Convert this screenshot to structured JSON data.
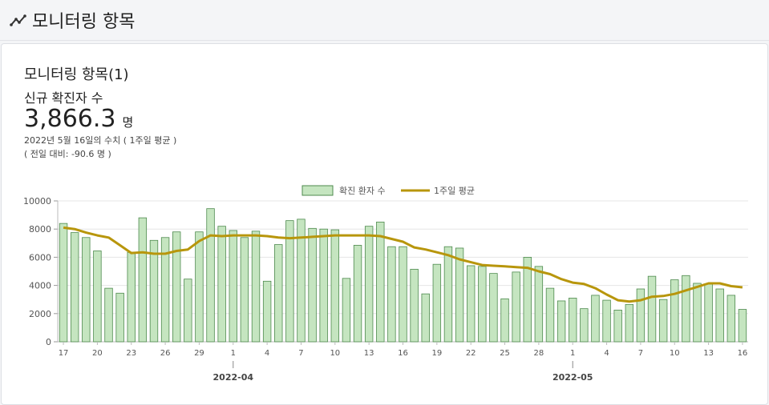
{
  "header": {
    "title": "모니터링 항목",
    "icon": "trend-line-icon"
  },
  "card": {
    "title": "모니터링 항목(1)",
    "metric_name": "신규 확진자 수",
    "metric_value": "3,866.3",
    "metric_unit": "명",
    "note_date": "2022년 5월 16일의 수치 ( 1주일 평균 )",
    "note_diff": "( 전일 대비: -90.6 명 )"
  },
  "colors": {
    "bar_fill": "#c5e5c0",
    "bar_stroke": "#4e8a4e",
    "line": "#b8960c",
    "grid": "#e6e6e6"
  },
  "chart_data": {
    "type": "bar",
    "legend": [
      "확진 환자 수",
      "1주일 평균"
    ],
    "legend_position": "top-center",
    "ylim": [
      0,
      10000
    ],
    "yticks": [
      0,
      2000,
      4000,
      6000,
      8000,
      10000
    ],
    "x_tick_labels": [
      "17",
      "20",
      "23",
      "26",
      "29",
      "1",
      "4",
      "7",
      "10",
      "13",
      "16",
      "19",
      "22",
      "25",
      "28",
      "1",
      "4",
      "7",
      "10",
      "13",
      "16"
    ],
    "month_labels": [
      "2022-04",
      "2022-05"
    ],
    "dates": [
      "2022-03-17",
      "2022-03-18",
      "2022-03-19",
      "2022-03-20",
      "2022-03-21",
      "2022-03-22",
      "2022-03-23",
      "2022-03-24",
      "2022-03-25",
      "2022-03-26",
      "2022-03-27",
      "2022-03-28",
      "2022-03-29",
      "2022-03-30",
      "2022-03-31",
      "2022-04-01",
      "2022-04-02",
      "2022-04-03",
      "2022-04-04",
      "2022-04-05",
      "2022-04-06",
      "2022-04-07",
      "2022-04-08",
      "2022-04-09",
      "2022-04-10",
      "2022-04-11",
      "2022-04-12",
      "2022-04-13",
      "2022-04-14",
      "2022-04-15",
      "2022-04-16",
      "2022-04-17",
      "2022-04-18",
      "2022-04-19",
      "2022-04-20",
      "2022-04-21",
      "2022-04-22",
      "2022-04-23",
      "2022-04-24",
      "2022-04-25",
      "2022-04-26",
      "2022-04-27",
      "2022-04-28",
      "2022-04-29",
      "2022-04-30",
      "2022-05-01",
      "2022-05-02",
      "2022-05-03",
      "2022-05-04",
      "2022-05-05",
      "2022-05-06",
      "2022-05-07",
      "2022-05-08",
      "2022-05-09",
      "2022-05-10",
      "2022-05-11",
      "2022-05-12",
      "2022-05-13",
      "2022-05-14",
      "2022-05-15",
      "2022-05-16"
    ],
    "series": [
      {
        "name": "확진 환자 수",
        "type": "bar",
        "values": [
          8400,
          7750,
          7400,
          6450,
          3800,
          3450,
          6350,
          8800,
          7200,
          7400,
          7800,
          4450,
          7800,
          9450,
          8200,
          7900,
          7400,
          7850,
          4300,
          6900,
          8600,
          8700,
          8050,
          8000,
          7950,
          4500,
          6850,
          8200,
          8500,
          6750,
          6750,
          5150,
          3400,
          5500,
          6750,
          6650,
          5400,
          5350,
          4850,
          3050,
          4950,
          6000,
          5350,
          3800,
          2900,
          3100,
          2350,
          3300,
          2950,
          2250,
          2650,
          3750,
          4650,
          3000,
          4400,
          4700,
          4150,
          4100,
          3750,
          3300,
          2300
        ]
      },
      {
        "name": "1주일 평균",
        "type": "line",
        "values": [
          8100,
          8000,
          7750,
          7550,
          7400,
          6850,
          6300,
          6350,
          6250,
          6250,
          6450,
          6550,
          7150,
          7550,
          7500,
          7550,
          7550,
          7550,
          7500,
          7400,
          7350,
          7400,
          7450,
          7500,
          7550,
          7550,
          7550,
          7550,
          7500,
          7300,
          7100,
          6700,
          6550,
          6350,
          6150,
          5850,
          5650,
          5450,
          5400,
          5350,
          5300,
          5250,
          5000,
          4800,
          4450,
          4200,
          4100,
          3800,
          3350,
          2950,
          2850,
          2950,
          3200,
          3250,
          3400,
          3650,
          3900,
          4150,
          4150,
          3950,
          3866
        ]
      }
    ]
  }
}
